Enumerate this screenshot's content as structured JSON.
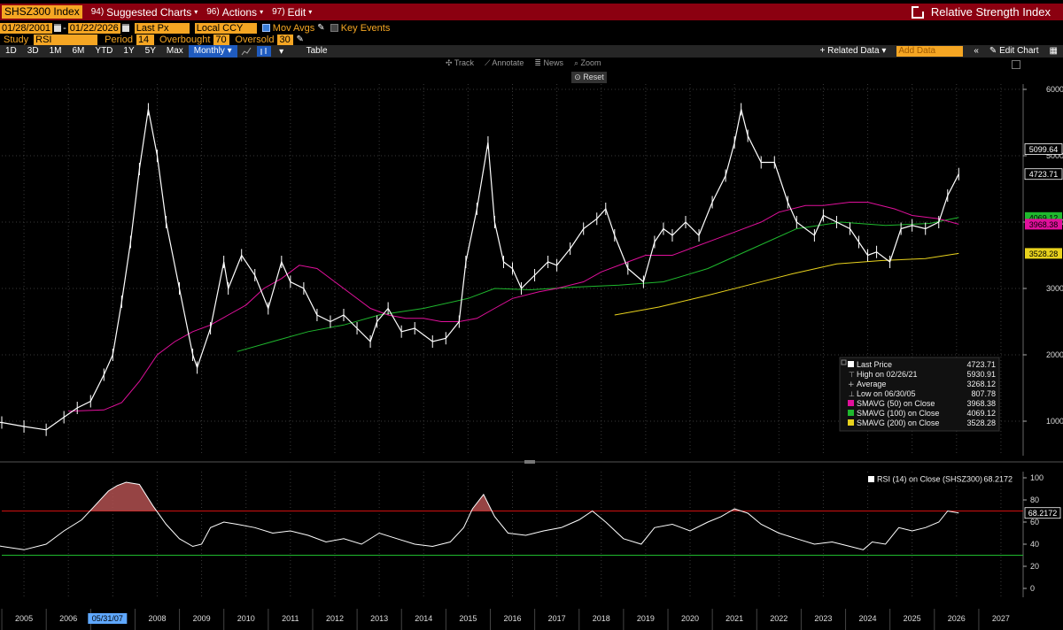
{
  "header": {
    "security": "SHSZ300 Index",
    "menus": [
      {
        "num": "94)",
        "label": "Suggested Charts"
      },
      {
        "num": "96)",
        "label": "Actions"
      },
      {
        "num": "97)",
        "label": "Edit"
      }
    ],
    "title": "Relative Strength Index"
  },
  "controls": {
    "start_date": "01/28/2001",
    "end_date": "01/22/2026",
    "price_field": "Last Px",
    "currency": "Local CCY",
    "mov_avgs": "Mov Avgs",
    "key_events": "Key Events",
    "study_label": "Study",
    "study": "RSI",
    "period_label": "Period",
    "period": "14",
    "overbought_label": "Overbought",
    "overbought": "70",
    "oversold_label": "Oversold",
    "oversold": "30"
  },
  "toolbar": {
    "ranges": [
      "1D",
      "3D",
      "1M",
      "6M",
      "YTD",
      "1Y",
      "5Y",
      "Max"
    ],
    "frequency": "Monthly",
    "table": "Table",
    "related_data": "+ Related Data",
    "add_data": "Add Data",
    "edit_chart": "Edit Chart"
  },
  "overlay_tools": [
    "Track",
    "Annotate",
    "News",
    "Zoom"
  ],
  "reset": "Reset",
  "colors": {
    "price": "#ffffff",
    "sma50": "#e0109b",
    "sma100": "#1fb82e",
    "sma200": "#e8d21d",
    "overbought": "#d01010",
    "oversold": "#1fb82e",
    "rsi_fill": "#b05050",
    "header_bg": "#8b0010",
    "field_bg": "#f5a623"
  },
  "chart_data": [
    {
      "type": "line",
      "title": "SHSZ300 Index",
      "x_label_years": [
        "2005",
        "2006",
        "2007",
        "2008",
        "2009",
        "2010",
        "2011",
        "2012",
        "2013",
        "2014",
        "2015",
        "2016",
        "2017",
        "2018",
        "2019",
        "2020",
        "2021",
        "2022",
        "2023",
        "2024",
        "2025",
        "2026",
        "2027"
      ],
      "x_cursor_label": "05/31/07",
      "y_ticks": [
        1000,
        2000,
        3000,
        4000,
        5000,
        6000
      ],
      "ylim": [
        300,
        6300
      ],
      "xlim": [
        2004.5,
        2027.5
      ],
      "series": [
        {
          "name": "Last Price",
          "x": [
            2004.0,
            2004.5,
            2005.0,
            2005.5,
            2005.9,
            2006.2,
            2006.5,
            2006.8,
            2007.0,
            2007.2,
            2007.4,
            2007.6,
            2007.8,
            2008.0,
            2008.2,
            2008.5,
            2008.8,
            2008.9,
            2009.2,
            2009.5,
            2009.6,
            2009.9,
            2010.2,
            2010.5,
            2010.8,
            2011.0,
            2011.3,
            2011.6,
            2011.9,
            2012.2,
            2012.5,
            2012.8,
            2012.95,
            2013.2,
            2013.5,
            2013.8,
            2014.2,
            2014.5,
            2014.8,
            2014.95,
            2015.2,
            2015.45,
            2015.6,
            2015.8,
            2016.0,
            2016.2,
            2016.5,
            2016.8,
            2017.0,
            2017.3,
            2017.6,
            2017.9,
            2018.1,
            2018.3,
            2018.6,
            2018.95,
            2019.2,
            2019.4,
            2019.6,
            2019.9,
            2020.2,
            2020.5,
            2020.8,
            2021.0,
            2021.15,
            2021.3,
            2021.6,
            2021.9,
            2022.2,
            2022.4,
            2022.8,
            2023.0,
            2023.3,
            2023.6,
            2023.8,
            2024.0,
            2024.2,
            2024.5,
            2024.75,
            2025.0,
            2025.3,
            2025.6,
            2025.8,
            2026.05
          ],
          "y": [
            1000,
            980,
            920,
            870,
            1060,
            1200,
            1300,
            1700,
            2000,
            2800,
            3700,
            4800,
            5700,
            5000,
            4000,
            3000,
            2000,
            1808,
            2400,
            3400,
            3000,
            3500,
            3200,
            2700,
            3400,
            3100,
            3000,
            2600,
            2500,
            2600,
            2400,
            2200,
            2500,
            2700,
            2350,
            2400,
            2200,
            2250,
            2500,
            3400,
            4200,
            5200,
            4000,
            3400,
            3300,
            3000,
            3200,
            3400,
            3350,
            3600,
            3900,
            4050,
            4200,
            3800,
            3300,
            3100,
            3700,
            3900,
            3800,
            4000,
            3800,
            4300,
            4700,
            5200,
            5700,
            5300,
            4900,
            4900,
            4300,
            4000,
            3800,
            4100,
            4000,
            3900,
            3700,
            3500,
            3550,
            3400,
            3900,
            3950,
            3900,
            4000,
            4400,
            4723.71
          ]
        },
        {
          "name": "SMAVG (50)",
          "x": [
            2006.0,
            2006.8,
            2007.2,
            2007.6,
            2008.0,
            2008.4,
            2008.8,
            2009.2,
            2009.6,
            2010.0,
            2010.4,
            2010.8,
            2011.2,
            2011.6,
            2012.0,
            2012.4,
            2012.8,
            2013.2,
            2013.6,
            2014.0,
            2014.4,
            2014.8,
            2015.2,
            2015.6,
            2016.0,
            2016.6,
            2017.0,
            2017.6,
            2018.0,
            2018.6,
            2019.0,
            2019.6,
            2020.0,
            2020.6,
            2021.0,
            2021.6,
            2022.0,
            2022.6,
            2023.0,
            2023.6,
            2024.0,
            2024.6,
            2025.0,
            2025.6,
            2026.05
          ],
          "y": [
            1150,
            1170,
            1280,
            1600,
            2000,
            2200,
            2350,
            2450,
            2600,
            2750,
            3000,
            3150,
            3350,
            3300,
            3100,
            2900,
            2700,
            2600,
            2550,
            2550,
            2500,
            2500,
            2550,
            2700,
            2850,
            2950,
            3000,
            3100,
            3250,
            3400,
            3500,
            3500,
            3600,
            3750,
            3850,
            4000,
            4150,
            4250,
            4250,
            4300,
            4300,
            4200,
            4100,
            4050,
            3968.38
          ]
        },
        {
          "name": "SMAVG (100)",
          "x": [
            2009.8,
            2010.6,
            2011.4,
            2012.2,
            2013.0,
            2014.0,
            2015.0,
            2015.6,
            2016.4,
            2017.4,
            2018.4,
            2019.4,
            2020.4,
            2021.4,
            2022.4,
            2023.4,
            2024.4,
            2025.4,
            2026.05
          ],
          "y": [
            2050,
            2200,
            2350,
            2450,
            2600,
            2700,
            2850,
            3000,
            2980,
            3020,
            3050,
            3100,
            3300,
            3600,
            3900,
            4000,
            3950,
            3980,
            4069.12
          ]
        },
        {
          "name": "SMAVG (200)",
          "x": [
            2018.3,
            2019.3,
            2020.3,
            2021.3,
            2022.3,
            2023.3,
            2024.3,
            2025.3,
            2026.05
          ],
          "y": [
            2600,
            2720,
            2880,
            3050,
            3220,
            3370,
            3420,
            3450,
            3528.28
          ]
        }
      ],
      "right_labels": [
        {
          "text": "5099.64",
          "value": 5099.64,
          "color": "#ffffff"
        },
        {
          "text": "4723.71",
          "value": 4723.71,
          "color": "#ffffff"
        },
        {
          "text": "4069.12",
          "value": 4069.12,
          "color": "#1fb82e"
        },
        {
          "text": "3968.38",
          "value": 3968.38,
          "color": "#e0109b"
        },
        {
          "text": "3528.28",
          "value": 3528.28,
          "color": "#e8d21d"
        }
      ],
      "legend": {
        "placement": "lower-right",
        "rows": [
          {
            "label": "Last Price",
            "value": "4723.71",
            "swatch": "#ffffff"
          },
          {
            "label": "High on 02/26/21",
            "value": "5930.91",
            "swatch": "marker-high"
          },
          {
            "label": "Average",
            "value": "3268.12",
            "swatch": "marker-avg"
          },
          {
            "label": "Low on 06/30/05",
            "value": "807.78",
            "swatch": "marker-low"
          },
          {
            "label": "SMAVG (50)  on Close",
            "value": "3968.38",
            "swatch": "#e0109b"
          },
          {
            "label": "SMAVG (100)  on Close",
            "value": "4069.12",
            "swatch": "#1fb82e"
          },
          {
            "label": "SMAVG (200)  on Close",
            "value": "3528.28",
            "swatch": "#e8d21d"
          }
        ]
      }
    },
    {
      "type": "line",
      "title": "RSI (14)  on Close (SHSZ300)",
      "legend_value": "68.2172",
      "y_ticks": [
        0,
        20,
        40,
        60,
        80,
        100
      ],
      "ylim": [
        -5,
        105
      ],
      "overbought": 70,
      "oversold": 30,
      "series": [
        {
          "name": "RSI (14) on Close (SHSZ300)",
          "x": [
            2004.0,
            2004.5,
            2005.0,
            2005.5,
            2005.9,
            2006.3,
            2006.6,
            2006.9,
            2007.1,
            2007.3,
            2007.6,
            2007.9,
            2008.2,
            2008.5,
            2008.8,
            2009.0,
            2009.2,
            2009.5,
            2009.8,
            2010.2,
            2010.6,
            2011.0,
            2011.4,
            2011.8,
            2012.2,
            2012.6,
            2013.0,
            2013.4,
            2013.8,
            2014.2,
            2014.6,
            2014.9,
            2015.1,
            2015.35,
            2015.6,
            2015.9,
            2016.3,
            2016.7,
            2017.1,
            2017.5,
            2017.8,
            2018.1,
            2018.5,
            2018.9,
            2019.2,
            2019.6,
            2020.0,
            2020.4,
            2020.7,
            2021.0,
            2021.3,
            2021.6,
            2022.0,
            2022.4,
            2022.8,
            2023.2,
            2023.6,
            2023.9,
            2024.1,
            2024.4,
            2024.7,
            2025.0,
            2025.3,
            2025.6,
            2025.8,
            2026.05
          ],
          "y": [
            42,
            38,
            35,
            40,
            52,
            62,
            75,
            88,
            93,
            96,
            94,
            75,
            58,
            45,
            38,
            40,
            55,
            60,
            58,
            55,
            50,
            52,
            48,
            42,
            45,
            40,
            50,
            45,
            40,
            38,
            42,
            55,
            72,
            85,
            65,
            50,
            48,
            52,
            55,
            62,
            70,
            60,
            45,
            40,
            55,
            58,
            52,
            60,
            65,
            72,
            68,
            58,
            50,
            45,
            40,
            42,
            38,
            35,
            42,
            40,
            55,
            52,
            55,
            60,
            70,
            68.2172
          ]
        }
      ]
    }
  ]
}
